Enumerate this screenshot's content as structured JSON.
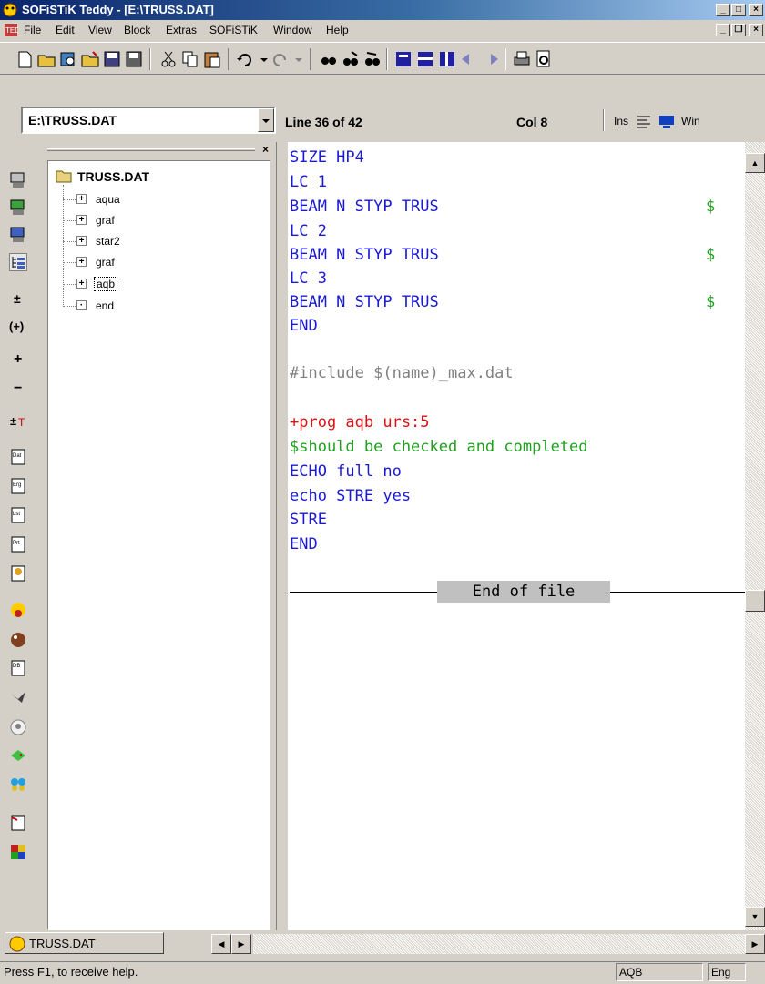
{
  "window": {
    "title": "SOFiSTiK Teddy - [E:\\TRUSS.DAT]"
  },
  "menu": [
    "File",
    "Edit",
    "View",
    "Block",
    "Extras",
    "SOFiSTiK",
    "Window",
    "Help"
  ],
  "toolbar2": {
    "file_combo_value": "E:\\TRUSS.DAT",
    "line_status": "Line  36 of 42",
    "col_status": "Col  8",
    "mode_ins": "Ins",
    "mode_win": "Win"
  },
  "tree": {
    "root": "TRUSS.DAT",
    "items": [
      {
        "label": "aqua",
        "expander": "+"
      },
      {
        "label": "graf",
        "expander": "+"
      },
      {
        "label": "star2",
        "expander": "+"
      },
      {
        "label": "graf",
        "expander": "+"
      },
      {
        "label": "aqb",
        "expander": "+"
      },
      {
        "label": "end",
        "expander": "·"
      }
    ]
  },
  "editor": {
    "lines": [
      "SIZE HP4",
      "LC 1",
      "BEAM N STYP TRUS",
      "LC 2",
      "BEAM N STYP TRUS",
      "LC 3",
      "BEAM N STYP TRUS",
      "END",
      "#include $(name)_max.dat",
      "+prog aqb urs:5",
      "$should be checked and completed",
      "ECHO full no",
      "echo STRE yes",
      "STRE",
      "END"
    ],
    "dollar": "$",
    "end_of_file": "End of file"
  },
  "bottom": {
    "doc_tab": "TRUSS.DAT"
  },
  "status": {
    "help": "Press F1, to receive help.",
    "panel1": "AQB",
    "panel2": "Eng"
  },
  "colors": {
    "keyword": "#1a1ad4",
    "prog": "#e01010",
    "comment": "#20a020",
    "include": "#808080"
  }
}
